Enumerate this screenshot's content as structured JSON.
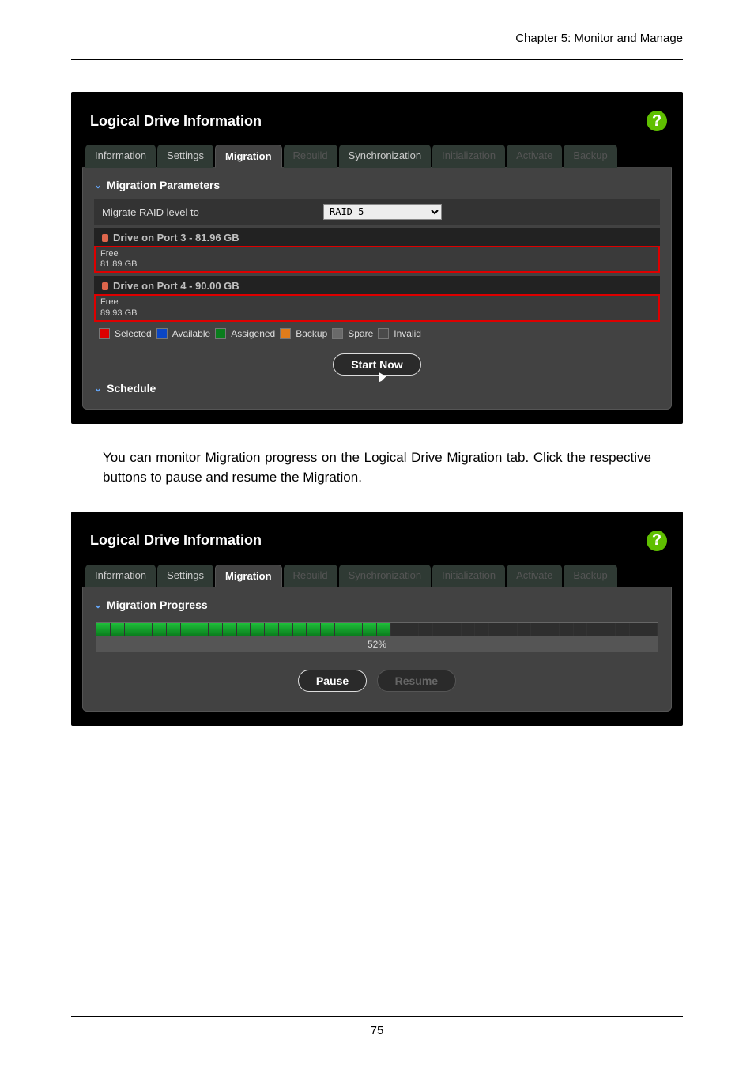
{
  "doc": {
    "chapter_header": "Chapter 5: Monitor and Manage",
    "body_text": "You can monitor Migration progress on the Logical Drive Migration tab. Click the respective buttons to pause and resume the Migration.",
    "page_number": "75"
  },
  "panel1": {
    "title": "Logical Drive Information",
    "help": "?",
    "tabs": {
      "information": "Information",
      "settings": "Settings",
      "migration": "Migration",
      "rebuild": "Rebuild",
      "synchronization": "Synchronization",
      "initialization": "Initialization",
      "activate": "Activate",
      "backup": "Backup"
    },
    "section_params": "Migration Parameters",
    "param_label": "Migrate RAID level to",
    "param_value": "RAID 5",
    "drives": [
      {
        "head": "Drive on Port 3 - 81.96 GB",
        "line1": "Free",
        "line2": "81.89 GB"
      },
      {
        "head": "Drive on Port 4 - 90.00 GB",
        "line1": "Free",
        "line2": "89.93 GB"
      }
    ],
    "legend": {
      "selected": "Selected",
      "available": "Available",
      "assigned": "Assigened",
      "backup": "Backup",
      "spare": "Spare",
      "invalid": "Invalid"
    },
    "start_btn": "Start Now",
    "section_schedule": "Schedule"
  },
  "panel2": {
    "title": "Logical Drive Information",
    "help": "?",
    "tabs": {
      "information": "Information",
      "settings": "Settings",
      "migration": "Migration",
      "rebuild": "Rebuild",
      "synchronization": "Synchronization",
      "initialization": "Initialization",
      "activate": "Activate",
      "backup": "Backup"
    },
    "section_progress": "Migration Progress",
    "progress_pct": "52%",
    "progress_fill": 52,
    "pause_btn": "Pause",
    "resume_btn": "Resume"
  }
}
